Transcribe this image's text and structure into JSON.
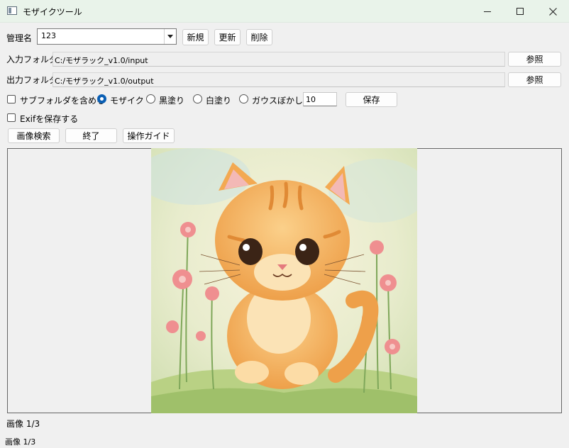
{
  "window": {
    "title": "モザイクツール"
  },
  "management": {
    "label": "管理名",
    "value": "123",
    "new_button": "新規",
    "update_button": "更新",
    "delete_button": "削除"
  },
  "input": {
    "label": "入力フォルダ",
    "path": "C:/モザラック_v1.0/input",
    "browse_button": "参照"
  },
  "output": {
    "label": "出力フォルダ",
    "path": "C:/モザラック_v1.0/output",
    "browse_button": "参照"
  },
  "options": {
    "include_subfolders": "サブフォルダを含める",
    "mode_mosaic": "モザイク",
    "mode_black": "黒塗り",
    "mode_white": "白塗り",
    "mode_blur": "ガウスぼかし",
    "strength_value": "10",
    "save_button": "保存",
    "keep_exif": "Exifを保存する"
  },
  "actions": {
    "search_button": "画像検索",
    "exit_button": "終了",
    "guide_button": "操作ガイド"
  },
  "status": {
    "image_counter": "画像 1/3",
    "statusbar_counter": "画像 1/3"
  }
}
